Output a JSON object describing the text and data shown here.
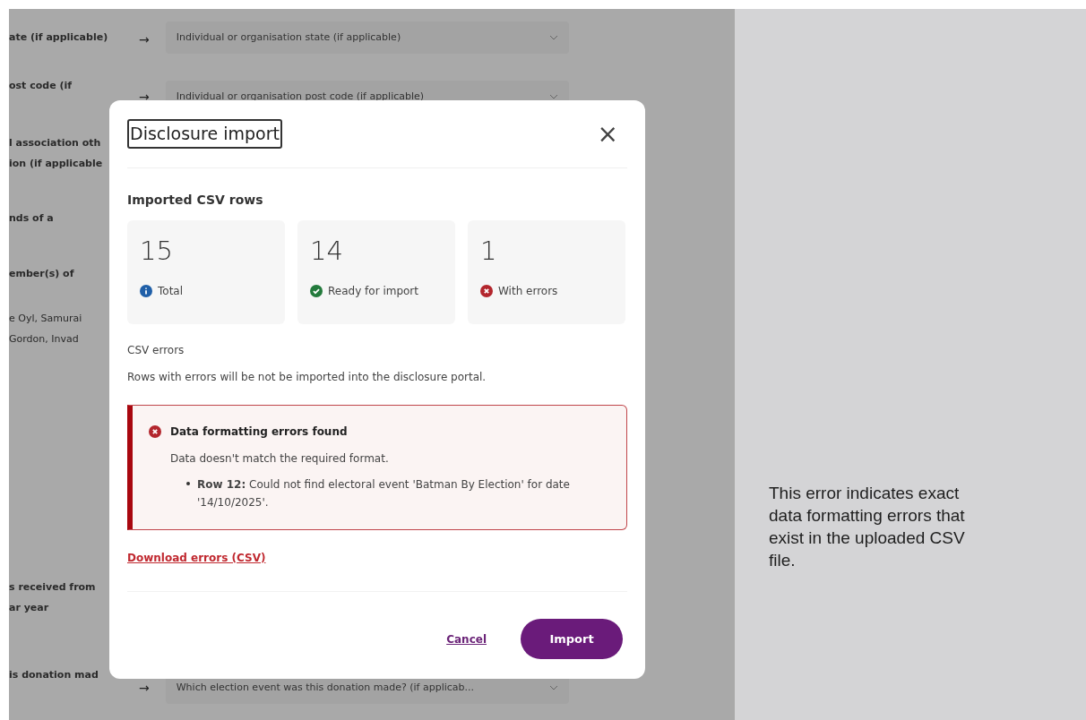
{
  "background_form": {
    "rows": [
      {
        "label": [
          "ate (if applicable)"
        ],
        "arrow": "→",
        "select": "Individual or organisation state (if applicable)"
      },
      {
        "label": [
          "ost code (if"
        ],
        "arrow": "→",
        "select": "Individual or organisation post code (if applicable)"
      },
      {
        "label": [
          "l association oth",
          "ion (if applicable"
        ]
      },
      {
        "label": [
          "nds of a"
        ]
      },
      {
        "label": [
          "ember(s) of"
        ]
      },
      {
        "label": [
          "e Oyl, Samurai",
          "Gordon, Invad"
        ],
        "kind": "value"
      },
      {
        "label": [
          "s received from",
          "ar year"
        ]
      },
      {
        "label": [
          "is donation mad"
        ],
        "arrow": "→",
        "select": "Which election event was this donation made? (if applicab..."
      }
    ]
  },
  "dialog": {
    "title": "Disclosure import",
    "close": "×",
    "section_title": "Imported CSV rows",
    "stats": [
      {
        "value": "15",
        "label": "Total",
        "kind": "info"
      },
      {
        "value": "14",
        "label": "Ready for import",
        "kind": "success"
      },
      {
        "value": "1",
        "label": "With errors",
        "kind": "error"
      }
    ],
    "errors_heading": "CSV errors",
    "errors_note": "Rows with errors will be not be imported into the disclosure portal.",
    "alert": {
      "title": "Data formatting errors found",
      "message": "Data doesn't match the required format.",
      "items": [
        "**Row 12:** Could not find electoral event 'Batman By Election' for date '14/10/2025'."
      ]
    },
    "download_link": "Download errors (CSV)",
    "buttons": {
      "cancel": "Cancel",
      "import": "Import"
    }
  },
  "annotation": "This error indicates exact data formatting errors that exist in the uploaded CSV file."
}
